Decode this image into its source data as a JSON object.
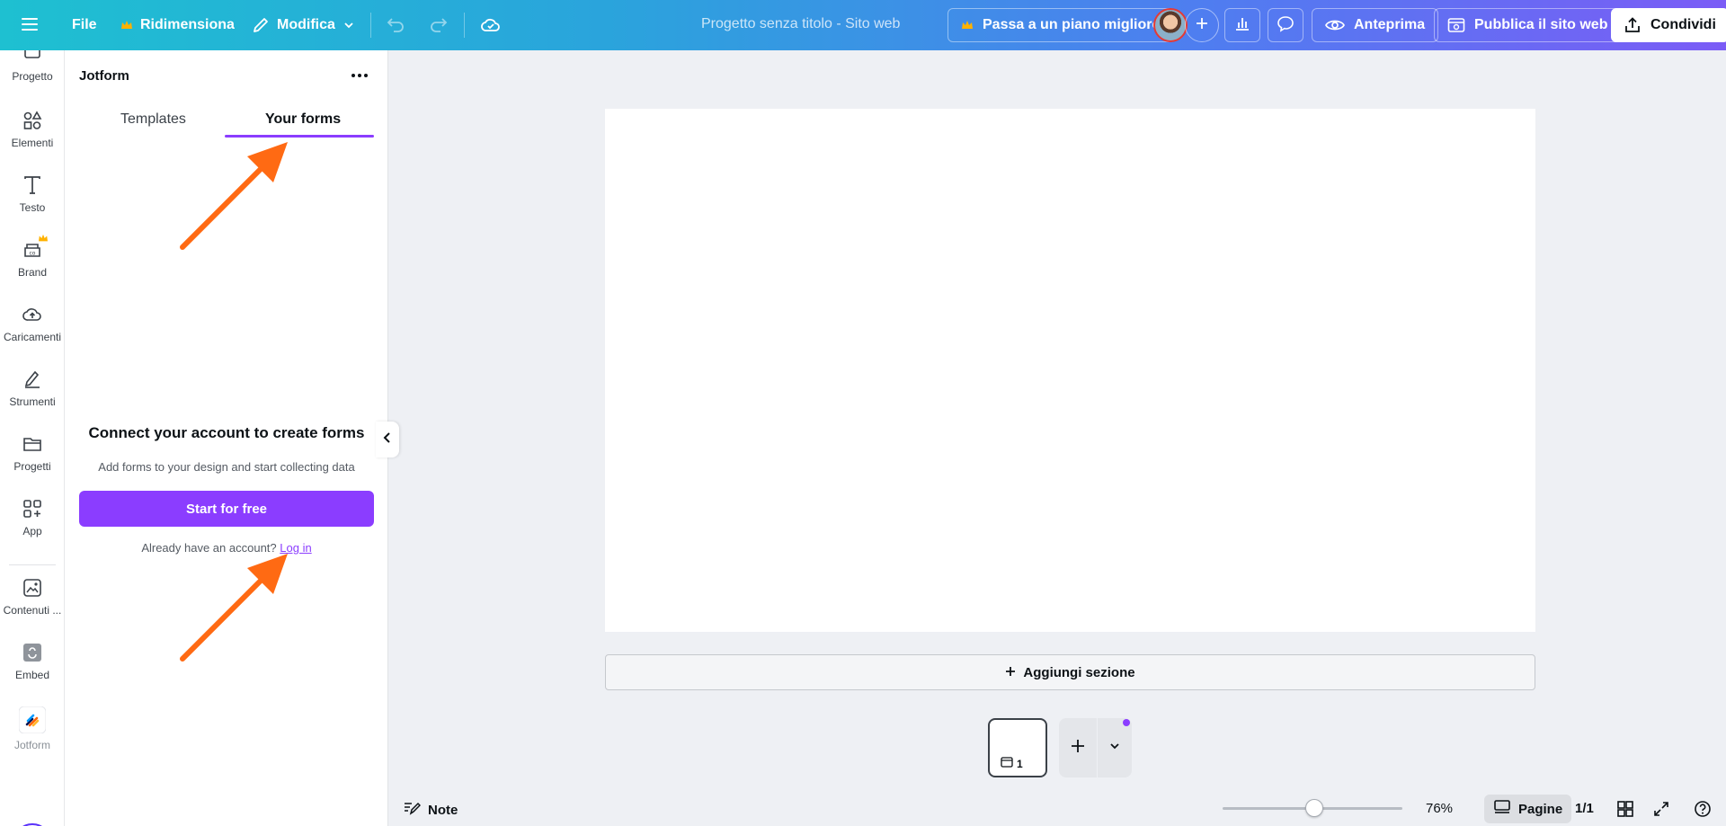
{
  "topbar": {
    "file_label": "File",
    "resize_label": "Ridimensiona",
    "edit_label": "Modifica",
    "doc_title": "Progetto senza titolo - Sito web",
    "upgrade_label": "Passa a un piano migliore",
    "preview_label": "Anteprima",
    "publish_label": "Pubblica il sito web",
    "share_label": "Condividi"
  },
  "rail": {
    "items": [
      {
        "label": "Progetto"
      },
      {
        "label": "Elementi"
      },
      {
        "label": "Testo"
      },
      {
        "label": "Brand"
      },
      {
        "label": "Caricamenti"
      },
      {
        "label": "Strumenti"
      },
      {
        "label": "Progetti"
      },
      {
        "label": "App"
      },
      {
        "label": "Contenuti ..."
      },
      {
        "label": "Embed"
      },
      {
        "label": "Jotform"
      }
    ]
  },
  "panel": {
    "title": "Jotform",
    "tabs": [
      {
        "label": "Templates"
      },
      {
        "label": "Your forms"
      }
    ],
    "connect_title": "Connect your account to create forms",
    "connect_sub": "Add forms to your design and start collecting data",
    "start_label": "Start for free",
    "already_text": "Already have an account?",
    "login_label": "Log in"
  },
  "canvas": {
    "add_section_label": "Aggiungi sezione",
    "page_number": "1"
  },
  "bottombar": {
    "notes_label": "Note",
    "zoom": "76%",
    "zoom_fraction": 0.76,
    "pages_label": "Pagine",
    "page_count": "1/1"
  },
  "colors": {
    "accent": "#8b3dff",
    "annotation_arrow": "#ff6a13",
    "topbar_start": "#1ec0d1",
    "topbar_end": "#7b5cf6"
  }
}
